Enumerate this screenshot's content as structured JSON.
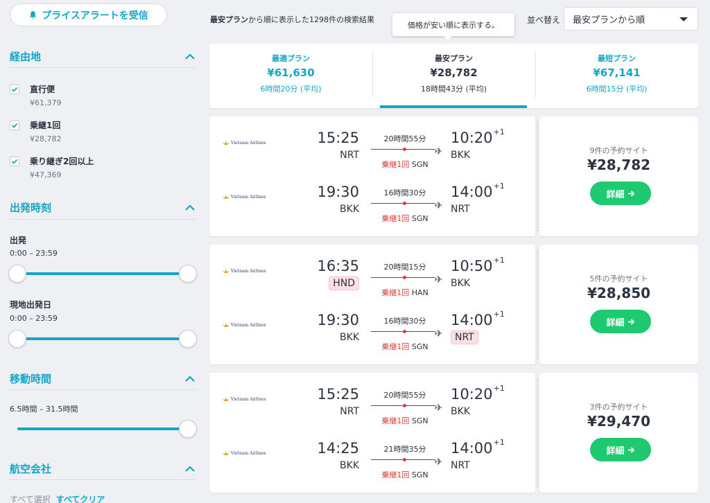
{
  "sidebar": {
    "alert_button": "プライスアラートを受信",
    "stops": {
      "title": "経由地",
      "options": [
        {
          "label": "直行便",
          "price": "¥61,379"
        },
        {
          "label": "乗継1回",
          "price": "¥28,782"
        },
        {
          "label": "乗り継ぎ2回以上",
          "price": "¥47,369"
        }
      ]
    },
    "departure": {
      "title": "出発時刻",
      "outbound_label": "出発",
      "outbound_range": "0:00 – 23:59",
      "return_label": "現地出発日",
      "return_range": "0:00 – 23:59"
    },
    "duration": {
      "title": "移動時間",
      "range": "6.5時間 – 31.5時間"
    },
    "airlines": {
      "title": "航空会社",
      "select_all": "すべて選択",
      "clear_all": "すべてクリア"
    }
  },
  "header": {
    "result_sort_name": "最安プラン",
    "result_text": "から順に表示した1298件の検索結果",
    "tooltip": "価格が安い順に表示する。",
    "sort_label": "並べ替え",
    "sort_value": "最安プランから順"
  },
  "plans": [
    {
      "name": "最適プラン",
      "price": "¥61,630",
      "time": "6時間20分 (平均)"
    },
    {
      "name": "最安プラン",
      "price": "¥28,782",
      "time": "18時間43分 (平均)"
    },
    {
      "name": "最短プラン",
      "price": "¥67,141",
      "time": "6時間15分 (平均)"
    }
  ],
  "results": [
    {
      "legs": [
        {
          "airline": "Vietnam Airlines",
          "dep_time": "15:25",
          "dep_code": "NRT",
          "arr_time": "10:20",
          "arr_offset": "+1",
          "arr_code": "BKK",
          "duration": "20時間55分",
          "stop_text": "乗継1回",
          "stop_code": "SGN"
        },
        {
          "airline": "Vietnam Airlines",
          "dep_time": "19:30",
          "dep_code": "BKK",
          "arr_time": "14:00",
          "arr_offset": "+1",
          "arr_code": "NRT",
          "duration": "16時間30分",
          "stop_text": "乗継1回",
          "stop_code": "SGN"
        }
      ],
      "sites": "9件の予約サイト",
      "price": "¥28,782",
      "button": "詳細"
    },
    {
      "legs": [
        {
          "airline": "Vietnam Airlines",
          "dep_time": "16:35",
          "dep_code": "HND",
          "arr_time": "10:50",
          "arr_offset": "+1",
          "arr_code": "BKK",
          "duration": "20時間15分",
          "stop_text": "乗継1回",
          "stop_code": "HAN"
        },
        {
          "airline": "Vietnam Airlines",
          "dep_time": "19:30",
          "dep_code": "BKK",
          "arr_time": "14:00",
          "arr_offset": "+1",
          "arr_code": "NRT",
          "duration": "16時間30分",
          "stop_text": "乗継1回",
          "stop_code": "SGN"
        }
      ],
      "sites": "5件の予約サイト",
      "price": "¥28,850",
      "button": "詳細"
    },
    {
      "legs": [
        {
          "airline": "Vietnam Airlines",
          "dep_time": "15:25",
          "dep_code": "NRT",
          "arr_time": "10:20",
          "arr_offset": "+1",
          "arr_code": "BKK",
          "duration": "20時間55分",
          "stop_text": "乗継1回",
          "stop_code": "SGN"
        },
        {
          "airline": "Vietnam Airlines",
          "dep_time": "14:25",
          "dep_code": "BKK",
          "arr_time": "14:00",
          "arr_offset": "+1",
          "arr_code": "NRT",
          "duration": "21時間35分",
          "stop_text": "乗継1回",
          "stop_code": "SGN"
        }
      ],
      "sites": "3件の予約サイト",
      "price": "¥29,470",
      "button": "詳細"
    }
  ],
  "colors": {
    "accent": "#13a6c7",
    "button_green": "#1ec96f",
    "stop_red": "#e33b3b",
    "highlight": "#fde0e3"
  }
}
